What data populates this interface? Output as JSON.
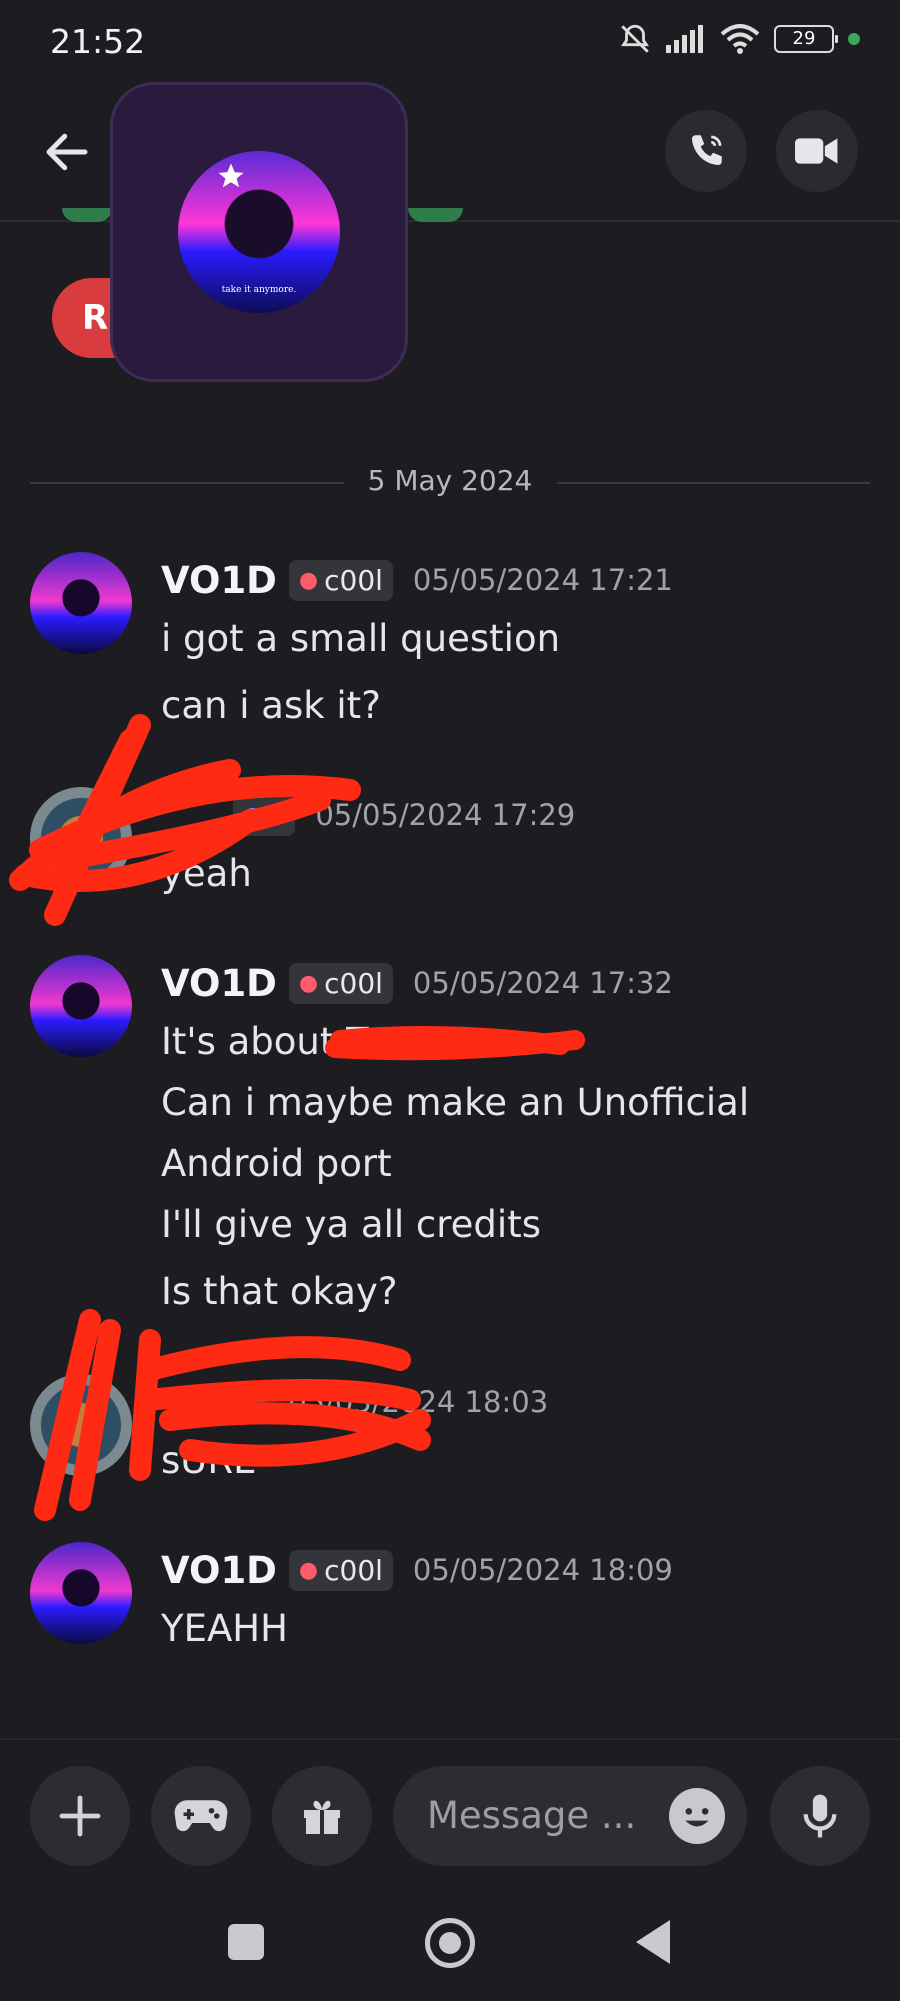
{
  "status_bar": {
    "time": "21:52",
    "battery": "29"
  },
  "header": {
    "call_icon": "phone-call-icon",
    "video_icon": "video-camera-icon",
    "back_icon": "arrow-left-icon"
  },
  "profile_popup": {
    "avatar_caption": "take it anymore."
  },
  "red_pill": {
    "letter": "R"
  },
  "date_divider": "5 May 2024",
  "messages": [
    {
      "username": "VO1D",
      "tag": "c00l",
      "timestamp": "05/05/2024 17:21",
      "lines": [
        "i got a small question",
        "can i ask it?"
      ]
    },
    {
      "username": "",
      "tag": "Y",
      "timestamp": "05/05/2024 17:29",
      "lines": [
        "yeah"
      ]
    },
    {
      "username": "VO1D",
      "tag": "c00l",
      "timestamp": "05/05/2024 17:32",
      "lines": [
        "It's about T",
        "Can i maybe make an Unofficial",
        "Android port",
        "I'll give ya all credits",
        "Is that okay?"
      ]
    },
    {
      "username": "",
      "tag": "",
      "timestamp": "05/05/2024 18:03",
      "lines": [
        "sURE"
      ]
    },
    {
      "username": "VO1D",
      "tag": "c00l",
      "timestamp": "05/05/2024 18:09",
      "lines": [
        "YEAHH"
      ]
    }
  ],
  "composer": {
    "placeholder": "Message ..."
  },
  "colors": {
    "background": "#1d1d21",
    "accent_green": "#3ba55d",
    "redact": "#ff2a14"
  }
}
